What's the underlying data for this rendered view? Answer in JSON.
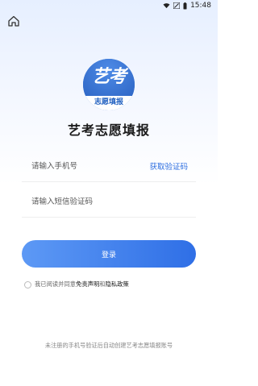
{
  "status_bar": {
    "time": "15:48"
  },
  "logo": {
    "main_text": "艺考",
    "sub_text": "志愿填报"
  },
  "app_title": "艺考志愿填报",
  "phone_field": {
    "placeholder": "请输入手机号",
    "value": ""
  },
  "get_code_label": "获取验证码",
  "sms_field": {
    "placeholder": "请输入短信验证码",
    "value": ""
  },
  "login_label": "登录",
  "agreement": {
    "prefix": "我已阅读并同意",
    "disclaimer_link": "免责声明",
    "conj": "和",
    "privacy_link": "隐私政策"
  },
  "footer_note": "未注册的手机号验证后自动创建艺考志愿填报账号",
  "colors": {
    "accent": "#2e6fe0",
    "logo_blue": "#3f7bd8"
  }
}
